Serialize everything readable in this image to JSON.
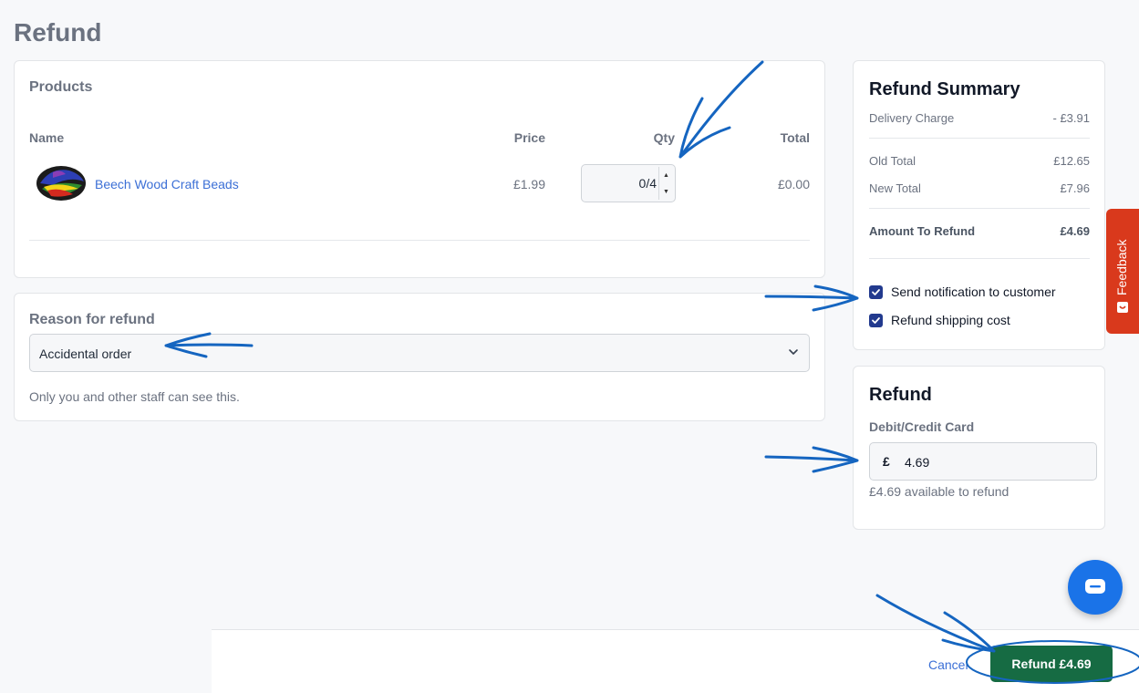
{
  "page": {
    "title": "Refund"
  },
  "products": {
    "heading": "Products",
    "columns": {
      "name": "Name",
      "price": "Price",
      "qty": "Qty",
      "total": "Total"
    },
    "items": [
      {
        "name": "Beech Wood Craft Beads",
        "price": "£1.99",
        "qty": "0/4",
        "total": "£0.00"
      }
    ]
  },
  "reason": {
    "heading": "Reason for refund",
    "selected": "Accidental order",
    "note": "Only you and other staff can see this."
  },
  "summary": {
    "title": "Refund Summary",
    "rows": [
      {
        "label": "Delivery Charge",
        "value": "- £3.91"
      },
      {
        "label": "Old Total",
        "value": "£12.65"
      },
      {
        "label": "New Total",
        "value": "£7.96"
      },
      {
        "label": "Amount To Refund",
        "value": "£4.69"
      }
    ],
    "options": [
      {
        "label": "Send notification to customer",
        "checked": true
      },
      {
        "label": "Refund shipping cost",
        "checked": true
      }
    ]
  },
  "refund": {
    "title": "Refund",
    "method": "Debit/Credit Card",
    "currency": "£",
    "amount": "4.69",
    "available": "£4.69 available to refund"
  },
  "feedback": {
    "label": "Feedback"
  },
  "footer": {
    "cancel": "Cancel",
    "submit": "Refund £4.69"
  },
  "colors": {
    "accent": "#3b6fd6",
    "primary_button": "#166b43",
    "feedback_tab": "#d9391c",
    "checkbox": "#223a8e",
    "chat": "#1a73e8",
    "annotation": "#1565c0"
  },
  "icons": [
    "chevron-down-icon",
    "check-icon",
    "chat-icon",
    "feedback-icon",
    "spin-up-icon",
    "spin-down-icon"
  ]
}
